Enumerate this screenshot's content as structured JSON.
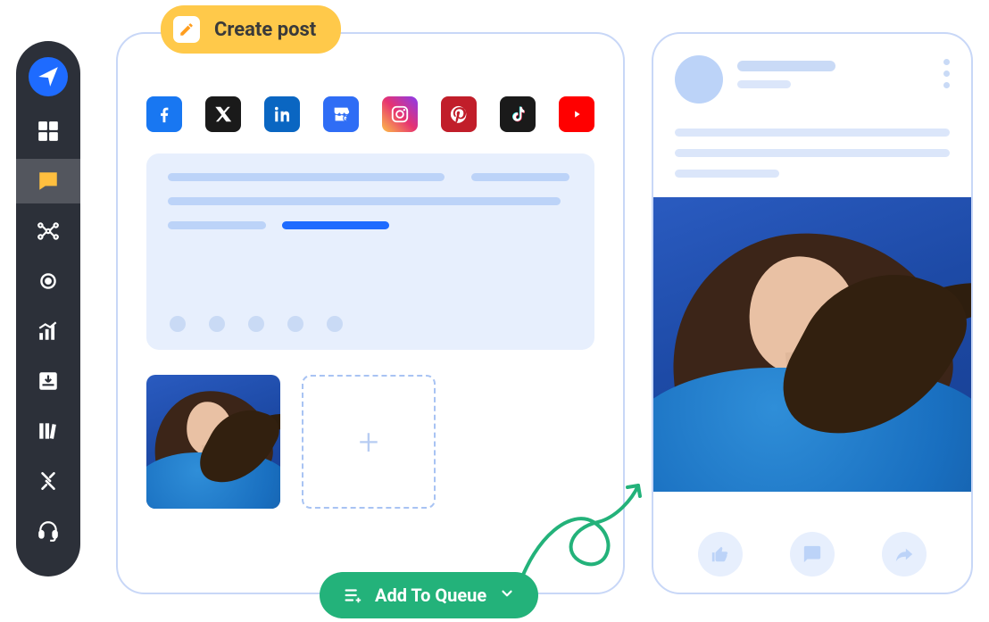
{
  "sidebar": {
    "items": [
      {
        "name": "navigator",
        "icon": "paper-plane"
      },
      {
        "name": "dashboard",
        "icon": "grid"
      },
      {
        "name": "compose",
        "icon": "message-edit",
        "active": true
      },
      {
        "name": "distribute",
        "icon": "network"
      },
      {
        "name": "target",
        "icon": "target"
      },
      {
        "name": "analytics",
        "icon": "chart"
      },
      {
        "name": "inbox",
        "icon": "download-tray"
      },
      {
        "name": "library",
        "icon": "books"
      },
      {
        "name": "settings",
        "icon": "tools"
      },
      {
        "name": "support",
        "icon": "headset"
      }
    ]
  },
  "createPost": {
    "label": "Create post"
  },
  "social": {
    "facebook": "Facebook",
    "x": "X",
    "linkedin": "LinkedIn",
    "google": "Google Business",
    "instagram": "Instagram",
    "pinterest": "Pinterest",
    "tiktok": "TikTok",
    "youtube": "YouTube"
  },
  "queue": {
    "label": "Add To Queue"
  },
  "previewActions": {
    "like": "Like",
    "comment": "Comment",
    "share": "Share"
  },
  "mediaAdd": {
    "glyph": "+"
  }
}
